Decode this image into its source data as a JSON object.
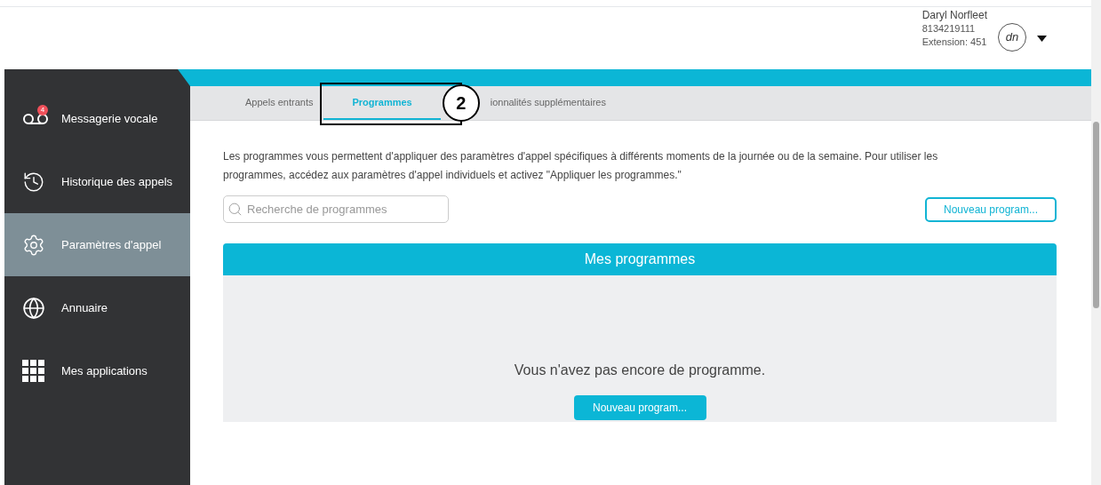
{
  "user": {
    "name": "Daryl Norfleet",
    "phone": "8134219111",
    "extension": "Extension: 451",
    "initials": "dn"
  },
  "sidebar": {
    "items": [
      {
        "kind": "voicemail",
        "label": "Messagerie vocale",
        "badge": "4",
        "selected": false
      },
      {
        "kind": "history",
        "label": "Historique des appels",
        "selected": false
      },
      {
        "kind": "settings",
        "label": "Paramètres d'appel",
        "selected": true
      },
      {
        "kind": "directory",
        "label": "Annuaire",
        "selected": false
      },
      {
        "kind": "apps",
        "label": "Mes applications",
        "selected": false
      }
    ]
  },
  "tabs": [
    {
      "label": "Appels entrants",
      "selected": false
    },
    {
      "label": "Programmes",
      "selected": true,
      "annotation": "2"
    },
    {
      "label": "ionnalités supplémentaires",
      "selected": false
    }
  ],
  "description": "Les programmes vous permettent d'appliquer des paramètres d'appel spécifiques à différents moments de la journée ou de la semaine. Pour utiliser les programmes, accédez aux paramètres d'appel individuels et activez \"Appliquer les programmes.\"",
  "search": {
    "placeholder": "Recherche de programmes"
  },
  "new_button": "Nouveau program...",
  "panel": {
    "title": "Mes programmes",
    "empty_message": "Vous n'avez pas encore de programme.",
    "button": "Nouveau program..."
  }
}
